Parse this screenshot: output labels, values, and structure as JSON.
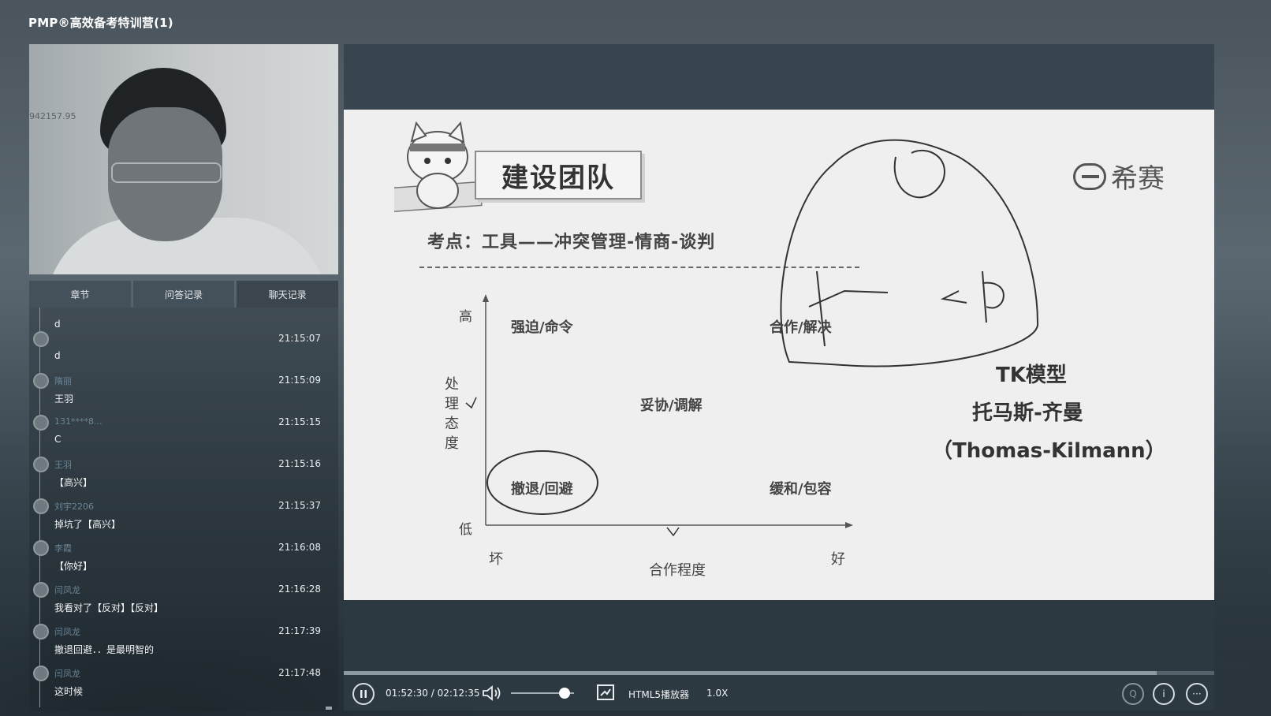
{
  "app": {
    "title": "PMP®高效备考特训营(1)"
  },
  "webcam": {
    "watermark": "942157.95"
  },
  "tabs": [
    {
      "label": "章节"
    },
    {
      "label": "问答记录"
    },
    {
      "label": "聊天记录",
      "active": true
    }
  ],
  "chat": {
    "top_message": "d",
    "messages": [
      {
        "name": "",
        "time": "21:15:07",
        "text": "d"
      },
      {
        "name": "隋丽",
        "time": "21:15:09",
        "text": "王羽"
      },
      {
        "name": "131****8...",
        "time": "21:15:15",
        "text": "C"
      },
      {
        "name": "王羽",
        "time": "21:15:16",
        "text": "【高兴】"
      },
      {
        "name": "刘宇2206",
        "time": "21:15:37",
        "text": "掉坑了【高兴】"
      },
      {
        "name": "李霞",
        "time": "21:16:08",
        "text": "【你好】"
      },
      {
        "name": "闫凤龙",
        "time": "21:16:28",
        "text": "我看对了【反对】【反对】"
      },
      {
        "name": "闫凤龙",
        "time": "21:17:39",
        "text": "撤退回避．．是最明智的"
      },
      {
        "name": "闫凤龙",
        "time": "21:17:48",
        "text": "这时候"
      }
    ]
  },
  "slide": {
    "title": "建设团队",
    "logo_text": "希赛",
    "subtitle": "考点：工具——冲突管理-情商-谈判",
    "y_high": "高",
    "y_low": "低",
    "y_label": "处理态度",
    "x_left": "坏",
    "x_right": "好",
    "x_label": "合作程度",
    "quadrants": {
      "top_left": "强迫/命令",
      "top_right": "合作/解决",
      "center": "妥协/调解",
      "bottom_left": "撤退/回避",
      "bottom_right": "缓和/包容"
    },
    "model_line1": "TK模型",
    "model_line2": "托马斯-齐曼",
    "model_line3": "（Thomas-Kilmann）"
  },
  "player": {
    "time": "01:52:30 / 02:12:35",
    "player_name": "HTML5播放器",
    "speed": "1.0X",
    "progress": 0.934,
    "volume": 0.85
  }
}
